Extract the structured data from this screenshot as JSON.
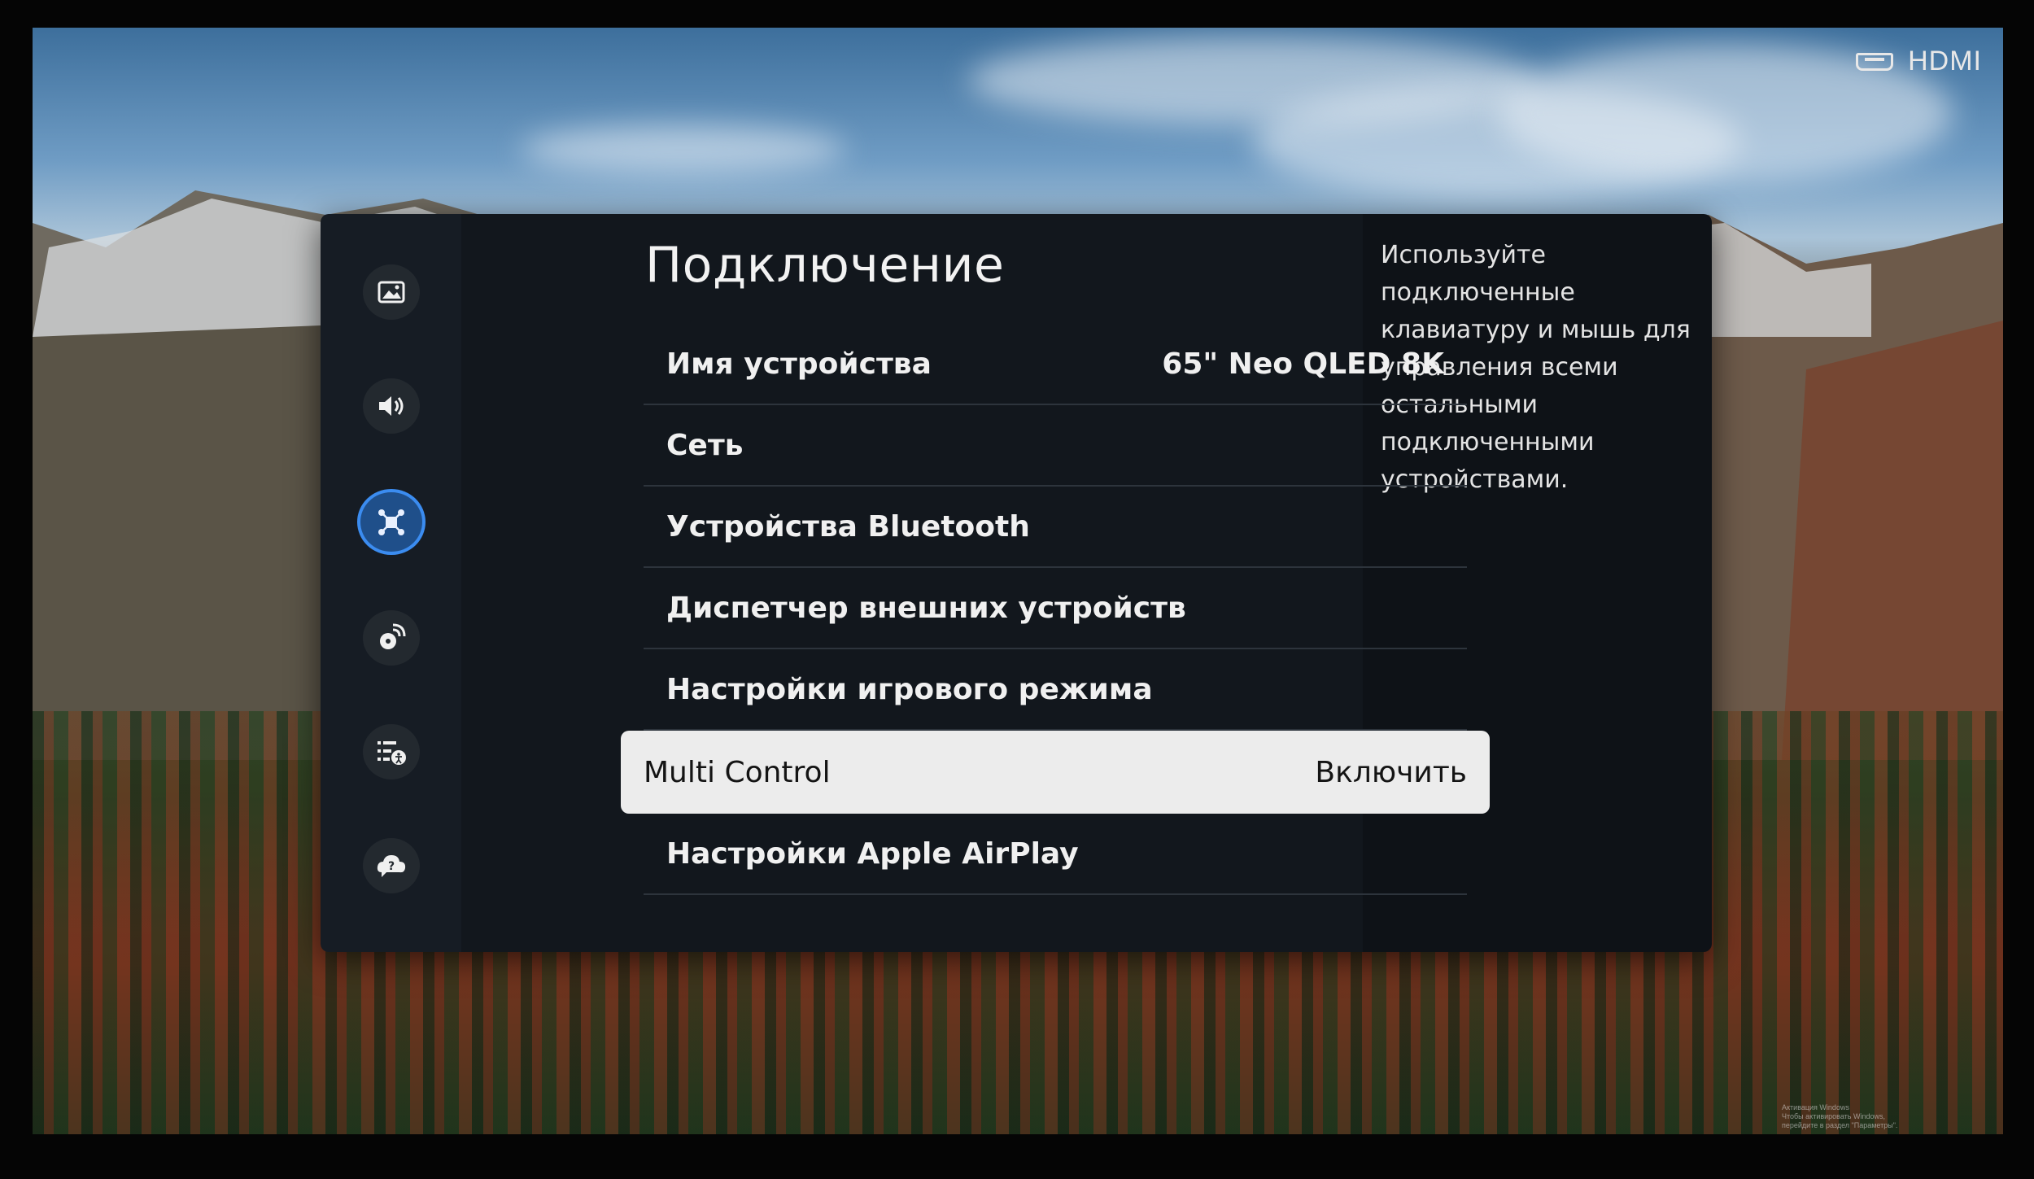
{
  "source": {
    "label": "HDMI",
    "icon": "hdmi-icon"
  },
  "panel": {
    "title": "Подключение",
    "rail": [
      {
        "name": "picture-icon",
        "active": false
      },
      {
        "name": "sound-icon",
        "active": false
      },
      {
        "name": "connection-icon",
        "active": true
      },
      {
        "name": "broadcast-icon",
        "active": false
      },
      {
        "name": "accessibility-icon",
        "active": false
      },
      {
        "name": "support-icon",
        "active": false
      }
    ],
    "menu": [
      {
        "label": "Имя устройства",
        "value": "65\" Neo QLED 8K",
        "selected": false
      },
      {
        "label": "Сеть",
        "value": "",
        "selected": false
      },
      {
        "label": "Устройства Bluetooth",
        "value": "",
        "selected": false
      },
      {
        "label": "Диспетчер внешних устройств",
        "value": "",
        "selected": false
      },
      {
        "label": "Настройки игрового режима",
        "value": "",
        "selected": false
      },
      {
        "label": "Multi Control",
        "value": "Включить",
        "selected": true
      },
      {
        "label": "Настройки Apple AirPlay",
        "value": "",
        "selected": false
      }
    ],
    "description": "Используйте подключенные клавиатуру и мышь для управления всеми остальными подключенными устройствами."
  },
  "watermark": {
    "line1": "Активация Windows",
    "line2": "Чтобы активировать Windows, перейдите в раздел \"Параметры\"."
  },
  "colors": {
    "accent": "#3b8cf0",
    "panel_bg": "#12171d",
    "selected_bg": "#ececec"
  }
}
